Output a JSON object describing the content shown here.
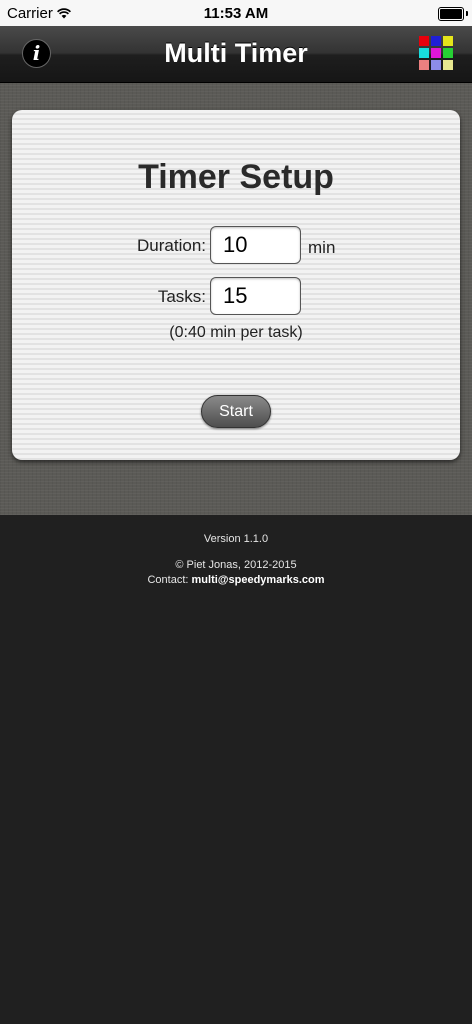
{
  "status_bar": {
    "carrier": "Carrier",
    "time": "11:53 AM"
  },
  "nav": {
    "title": "Multi Timer",
    "info_symbol": "i",
    "grid_colors": [
      "#e8000b",
      "#1f1fd6",
      "#e5e51a",
      "#18dcdc",
      "#e016d8",
      "#26d034",
      "#ec8080",
      "#8c8ce8",
      "#e8e890"
    ]
  },
  "card": {
    "title": "Timer Setup",
    "duration_label": "Duration:",
    "duration_value": "10",
    "duration_unit": "min",
    "tasks_label": "Tasks:",
    "tasks_value": "15",
    "per_task": "(0:40 min per task)",
    "start_label": "Start"
  },
  "footer": {
    "version": "Version 1.1.0",
    "copyright": "© Piet Jonas, 2012-2015",
    "contact_label": "Contact:",
    "contact_email": "multi@speedymarks.com"
  }
}
